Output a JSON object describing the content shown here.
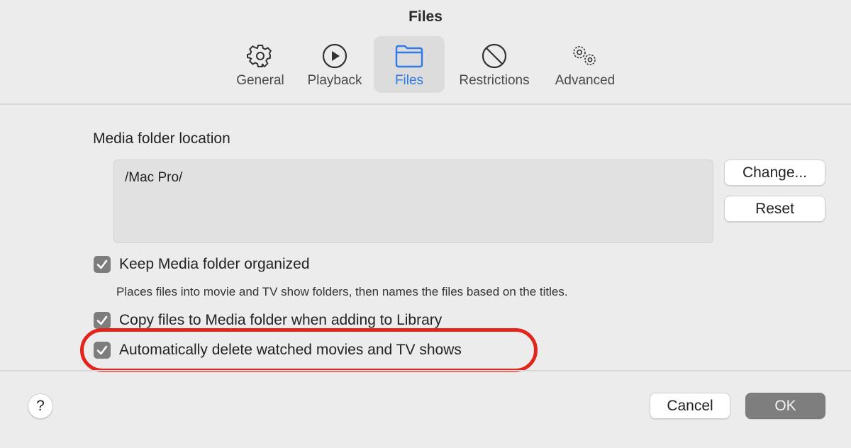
{
  "window": {
    "title": "Files"
  },
  "tabs": [
    {
      "id": "general",
      "label": "General",
      "icon": "gear-icon",
      "active": false
    },
    {
      "id": "playback",
      "label": "Playback",
      "icon": "play-circle-icon",
      "active": false
    },
    {
      "id": "files",
      "label": "Files",
      "icon": "folder-icon",
      "active": true
    },
    {
      "id": "restrictions",
      "label": "Restrictions",
      "icon": "prohibited-icon",
      "active": false
    },
    {
      "id": "advanced",
      "label": "Advanced",
      "icon": "gears-icon",
      "active": false
    }
  ],
  "media_folder": {
    "label": "Media folder location",
    "path": "/Mac Pro/",
    "change_label": "Change...",
    "reset_label": "Reset"
  },
  "options": [
    {
      "label": "Keep Media folder organized",
      "checked": true
    },
    {
      "label": "Copy files to Media folder when adding to Library",
      "checked": true
    },
    {
      "label": "Automatically delete watched movies and TV shows",
      "checked": true,
      "highlighted": true
    }
  ],
  "hint": "Places files into movie and TV show folders, then names the files based on the titles.",
  "footer": {
    "help_label": "?",
    "cancel_label": "Cancel",
    "ok_label": "OK"
  },
  "colors": {
    "accent": "#2f7ae5",
    "highlight": "#e3241b",
    "checkbox": "#7d7d7d"
  }
}
